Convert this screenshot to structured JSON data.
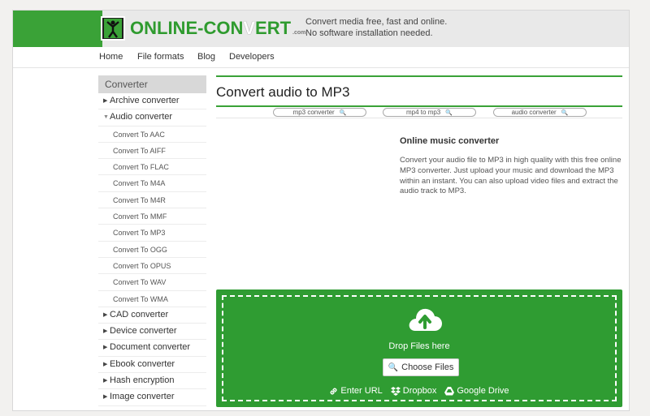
{
  "header": {
    "logo_left": "ONLINE-CON",
    "logo_white": "V",
    "logo_right": "ERT",
    "logo_com": ".com",
    "tagline_line1": "Convert media free, fast and online.",
    "tagline_line2": "No software installation needed."
  },
  "nav": [
    "Home",
    "File formats",
    "Blog",
    "Developers"
  ],
  "sidebar": {
    "title": "Converter",
    "items_top": [
      {
        "label": "Archive converter",
        "expanded": false
      },
      {
        "label": "Audio converter",
        "expanded": true
      }
    ],
    "sub_items": [
      "Convert To AAC",
      "Convert To AIFF",
      "Convert To FLAC",
      "Convert To M4A",
      "Convert To M4R",
      "Convert To MMF",
      "Convert To MP3",
      "Convert To OGG",
      "Convert To OPUS",
      "Convert To WAV",
      "Convert To WMA"
    ],
    "items_bottom": [
      "CAD converter",
      "Device converter",
      "Document converter",
      "Ebook converter",
      "Hash encryption",
      "Image converter"
    ]
  },
  "main": {
    "title": "Convert audio to MP3",
    "quicklinks": [
      "mp3 converter",
      "mp4 to mp3",
      "audio converter"
    ],
    "info_heading": "Online music converter",
    "info_text": "Convert your audio file to MP3 in high quality with this free online MP3 converter. Just upload your music and download the MP3 within an instant. You can also upload video files and extract the audio track to MP3."
  },
  "drop": {
    "drop_text": "Drop Files here",
    "choose_label": "Choose Files",
    "enter_url": "Enter URL",
    "dropbox": "Dropbox",
    "google_drive": "Google Drive"
  },
  "colors": {
    "brand_green": "#3aa237",
    "drop_green": "#2f9c32"
  },
  "icons": [
    "logo-figure-icon",
    "cloud-upload-icon",
    "search-icon",
    "link-icon",
    "dropbox-icon",
    "google-drive-icon",
    "triangle-right-icon",
    "triangle-down-icon"
  ]
}
